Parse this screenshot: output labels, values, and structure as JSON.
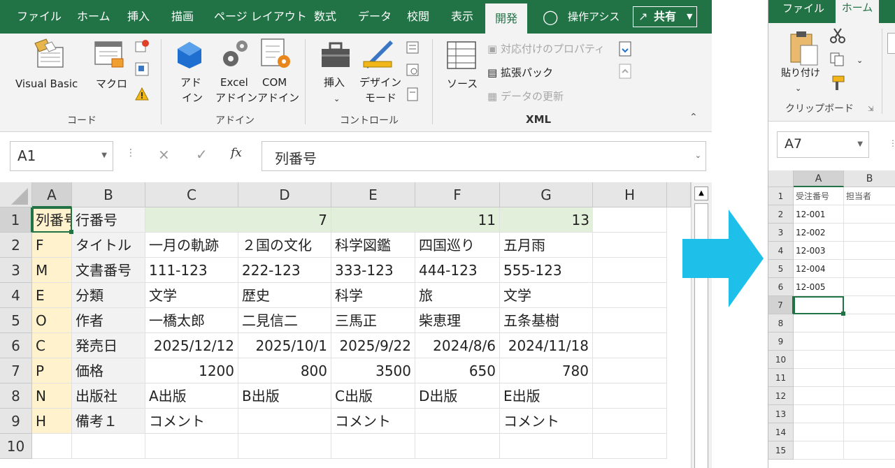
{
  "left_window": {
    "tabs": [
      "ファイル",
      "ホーム",
      "挿入",
      "描画",
      "ページ レイアウト",
      "数式",
      "データ",
      "校閲",
      "表示",
      "開発",
      "操作アシス"
    ],
    "active_tab": "開発",
    "share_label": "共有",
    "ribbon": {
      "code_group": {
        "visual_basic": "Visual Basic",
        "macro": "マクロ",
        "label": "コード"
      },
      "addin_group": {
        "addin_1": "アド",
        "addin_2": "イン",
        "excel_addin_1": "Excel",
        "excel_addin_2": "アドイン",
        "com_addin_1": "COM",
        "com_addin_2": "アドイン",
        "label": "アドイン"
      },
      "control_group": {
        "insert": "挿入",
        "design_1": "デザイン",
        "design_2": "モード",
        "label": "コントロール"
      },
      "xml_group": {
        "source": "ソース",
        "map_props": "対応付けのプロパティ",
        "expansion": "拡張パック",
        "refresh": "データの更新",
        "label": "XML"
      }
    },
    "name_box": "A1",
    "formula": "列番号",
    "formula_icons": {
      "cancel": "×",
      "enter": "✓",
      "fx": "fx"
    },
    "columns": [
      "A",
      "B",
      "C",
      "D",
      "E",
      "F",
      "G",
      "H"
    ],
    "rows": [
      [
        "列番号",
        "行番号",
        "7",
        "",
        "11",
        "",
        "13",
        ""
      ],
      [
        "F",
        "タイトル",
        "一月の軌跡",
        "２国の文化",
        "科学図鑑",
        "四国巡り",
        "五月雨",
        ""
      ],
      [
        "M",
        "文書番号",
        "111-123",
        "222-123",
        "333-123",
        "444-123",
        "555-123",
        ""
      ],
      [
        "E",
        "分類",
        "文学",
        "歴史",
        "科学",
        "旅",
        "文学",
        ""
      ],
      [
        "O",
        "作者",
        "一橋太郎",
        "二見信二",
        "三馬正",
        "柴恵理",
        "五条基樹",
        ""
      ],
      [
        "C",
        "発売日",
        "2025/12/12",
        "2025/10/1",
        "2025/9/22",
        "2024/8/6",
        "2024/11/18",
        ""
      ],
      [
        "P",
        "価格",
        "1200",
        "800",
        "3500",
        "650",
        "780",
        ""
      ],
      [
        "N",
        "出版社",
        "A出版",
        "B出版",
        "C出版",
        "D出版",
        "E出版",
        ""
      ],
      [
        "H",
        "備考１",
        "コメント",
        "",
        "コメント",
        "",
        "コメント",
        ""
      ],
      [
        "",
        "",
        "",
        "",
        "",
        "",
        "",
        ""
      ]
    ],
    "row_numbers": [
      "1",
      "2",
      "3",
      "4",
      "5",
      "6",
      "7",
      "8",
      "9",
      "10"
    ]
  },
  "right_window": {
    "tabs": [
      "ファイル",
      "ホーム"
    ],
    "active_tab": "ホーム",
    "paste_label": "貼り付け",
    "clipboard_label": "クリップボード",
    "name_box": "A7",
    "columns": [
      "A",
      "B"
    ],
    "header_row": [
      "受注番号",
      "担当者"
    ],
    "rows": [
      [
        "12-001",
        ""
      ],
      [
        "12-002",
        ""
      ],
      [
        "12-003",
        ""
      ],
      [
        "12-004",
        ""
      ],
      [
        "12-005",
        ""
      ]
    ],
    "row_numbers": [
      "1",
      "2",
      "3",
      "4",
      "5",
      "6",
      "7",
      "8",
      "9",
      "10",
      "11",
      "12",
      "13",
      "14",
      "15"
    ]
  },
  "colors": {
    "excel_green": "#217346",
    "arrow_cyan": "#1ec0ea",
    "highlight_yellow": "#fff2cc",
    "highlight_green": "#e2efda"
  }
}
